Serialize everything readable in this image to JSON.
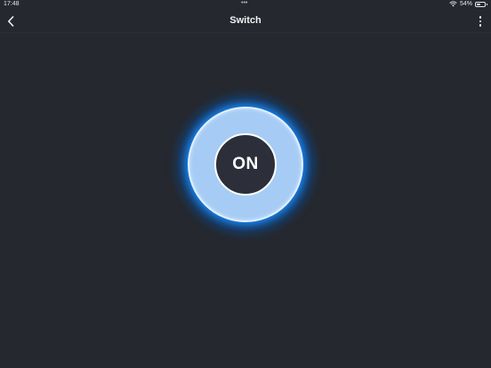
{
  "status_bar": {
    "time": "17:48",
    "center_indicator": "•••",
    "battery_text": "54%",
    "battery_level": 0.54,
    "icons": [
      "wifi-icon",
      "battery-icon"
    ]
  },
  "nav": {
    "back_icon": "chevron-left-icon",
    "title": "Switch",
    "more_icon": "more-vertical-icon"
  },
  "switch": {
    "label": "ON",
    "state": "on"
  },
  "colors": {
    "background": "#25282f",
    "ring": "#a6ccf5",
    "glow": "#1e8cff",
    "core": "#2c2f3a"
  }
}
